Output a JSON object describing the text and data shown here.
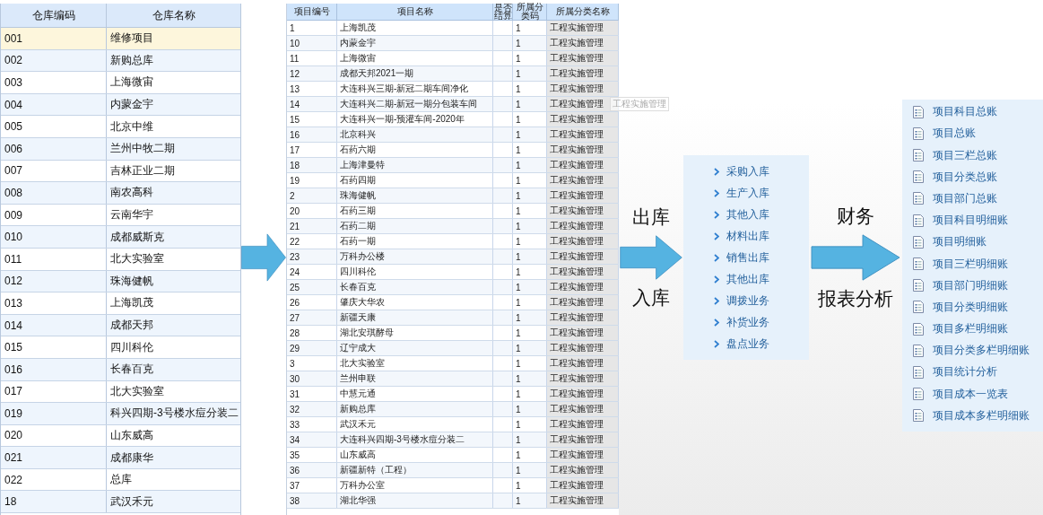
{
  "warehouse_table": {
    "columns": [
      "仓库编码",
      "仓库名称"
    ],
    "rows": [
      {
        "code": "001",
        "name": "维修项目",
        "selected": true
      },
      {
        "code": "002",
        "name": "新购总库",
        "selected": false
      },
      {
        "code": "003",
        "name": "上海微宙",
        "selected": false
      },
      {
        "code": "004",
        "name": "内蒙金宇",
        "selected": false
      },
      {
        "code": "005",
        "name": "北京中维",
        "selected": false
      },
      {
        "code": "006",
        "name": "兰州中牧二期",
        "selected": false
      },
      {
        "code": "007",
        "name": "吉林正业二期",
        "selected": false
      },
      {
        "code": "008",
        "name": "南农高科",
        "selected": false
      },
      {
        "code": "009",
        "name": "云南华宇",
        "selected": false
      },
      {
        "code": "010",
        "name": "成都威斯克",
        "selected": false
      },
      {
        "code": "011",
        "name": "北大实验室",
        "selected": false
      },
      {
        "code": "012",
        "name": "珠海健帆",
        "selected": false
      },
      {
        "code": "013",
        "name": "上海凯茂",
        "selected": false
      },
      {
        "code": "014",
        "name": "成都天邦",
        "selected": false
      },
      {
        "code": "015",
        "name": "四川科伦",
        "selected": false
      },
      {
        "code": "016",
        "name": "长春百克",
        "selected": false
      },
      {
        "code": "017",
        "name": "北大实验室",
        "selected": false
      },
      {
        "code": "019",
        "name": "科兴四期-3号楼水痘分装二",
        "selected": false
      },
      {
        "code": "020",
        "name": "山东威高",
        "selected": false
      },
      {
        "code": "021",
        "name": "成都康华",
        "selected": false
      },
      {
        "code": "022",
        "name": "总库",
        "selected": false
      },
      {
        "code": "18",
        "name": "武汉禾元",
        "selected": false
      }
    ]
  },
  "project_table": {
    "columns": [
      "项目编号",
      "项目名称",
      "是否结算",
      "所属分类码",
      "所属分类名称"
    ],
    "rows": [
      {
        "code": "1",
        "name": "上海凯茂",
        "class_code": "1",
        "class_name": "工程实施管理"
      },
      {
        "code": "10",
        "name": "内蒙金宇",
        "class_code": "1",
        "class_name": "工程实施管理"
      },
      {
        "code": "11",
        "name": "上海微宙",
        "class_code": "1",
        "class_name": "工程实施管理"
      },
      {
        "code": "12",
        "name": "成都天邦2021一期",
        "class_code": "1",
        "class_name": "工程实施管理"
      },
      {
        "code": "13",
        "name": "大连科兴三期-新冠二期车间净化",
        "class_code": "1",
        "class_name": "工程实施管理"
      },
      {
        "code": "14",
        "name": "大连科兴二期-新冠一期分包装车间",
        "class_code": "1",
        "class_name": "工程实施管理"
      },
      {
        "code": "15",
        "name": "大连科兴一期-预灌车间-2020年",
        "class_code": "1",
        "class_name": "工程实施管理"
      },
      {
        "code": "16",
        "name": "北京科兴",
        "class_code": "1",
        "class_name": "工程实施管理"
      },
      {
        "code": "17",
        "name": "石药六期",
        "class_code": "1",
        "class_name": "工程实施管理"
      },
      {
        "code": "18",
        "name": "上海津曼特",
        "class_code": "1",
        "class_name": "工程实施管理"
      },
      {
        "code": "19",
        "name": "石药四期",
        "class_code": "1",
        "class_name": "工程实施管理"
      },
      {
        "code": "2",
        "name": "珠海健帆",
        "class_code": "1",
        "class_name": "工程实施管理"
      },
      {
        "code": "20",
        "name": "石药三期",
        "class_code": "1",
        "class_name": "工程实施管理"
      },
      {
        "code": "21",
        "name": "石药二期",
        "class_code": "1",
        "class_name": "工程实施管理"
      },
      {
        "code": "22",
        "name": "石药一期",
        "class_code": "1",
        "class_name": "工程实施管理"
      },
      {
        "code": "23",
        "name": "万科办公楼",
        "class_code": "1",
        "class_name": "工程实施管理"
      },
      {
        "code": "24",
        "name": "四川科伦",
        "class_code": "1",
        "class_name": "工程实施管理"
      },
      {
        "code": "25",
        "name": "长春百克",
        "class_code": "1",
        "class_name": "工程实施管理"
      },
      {
        "code": "26",
        "name": "肇庆大华农",
        "class_code": "1",
        "class_name": "工程实施管理"
      },
      {
        "code": "27",
        "name": "新疆天康",
        "class_code": "1",
        "class_name": "工程实施管理"
      },
      {
        "code": "28",
        "name": "湖北安琪酵母",
        "class_code": "1",
        "class_name": "工程实施管理"
      },
      {
        "code": "29",
        "name": "辽宁成大",
        "class_code": "1",
        "class_name": "工程实施管理"
      },
      {
        "code": "3",
        "name": "北大实验室",
        "class_code": "1",
        "class_name": "工程实施管理"
      },
      {
        "code": "30",
        "name": "兰州申联",
        "class_code": "1",
        "class_name": "工程实施管理"
      },
      {
        "code": "31",
        "name": "中慧元通",
        "class_code": "1",
        "class_name": "工程实施管理"
      },
      {
        "code": "32",
        "name": "新购总库",
        "class_code": "1",
        "class_name": "工程实施管理"
      },
      {
        "code": "33",
        "name": "武汉禾元",
        "class_code": "1",
        "class_name": "工程实施管理"
      },
      {
        "code": "34",
        "name": "大连科兴四期-3号楼水痘分装二",
        "class_code": "1",
        "class_name": "工程实施管理"
      },
      {
        "code": "35",
        "name": "山东威高",
        "class_code": "1",
        "class_name": "工程实施管理"
      },
      {
        "code": "36",
        "name": "新疆新特（工程）",
        "class_code": "1",
        "class_name": "工程实施管理"
      },
      {
        "code": "37",
        "name": "万科办公室",
        "class_code": "1",
        "class_name": "工程实施管理"
      },
      {
        "code": "38",
        "name": "湖北华强",
        "class_code": "1",
        "class_name": "工程实施管理"
      }
    ],
    "drag_ghost": "工程实施管理"
  },
  "flow_arrow_1": {
    "label_above": "出库",
    "label_below": "入库"
  },
  "stock_menu": {
    "items": [
      "采购入库",
      "生产入库",
      "其他入库",
      "材料出库",
      "销售出库",
      "其他出库",
      "调拨业务",
      "补货业务",
      "盘点业务"
    ]
  },
  "flow_arrow_2": {
    "label_above": "财务",
    "label_below": "报表分析"
  },
  "report_menu": {
    "items": [
      "项目科目总账",
      "项目总账",
      "项目三栏总账",
      "项目分类总账",
      "项目部门总账",
      "项目科目明细账",
      "项目明细账",
      "项目三栏明细账",
      "项目部门明细账",
      "项目分类明细账",
      "项目多栏明细账",
      "项目分类多栏明细账",
      "项目统计分析",
      "项目成本一览表",
      "项目成本多栏明细账"
    ]
  }
}
